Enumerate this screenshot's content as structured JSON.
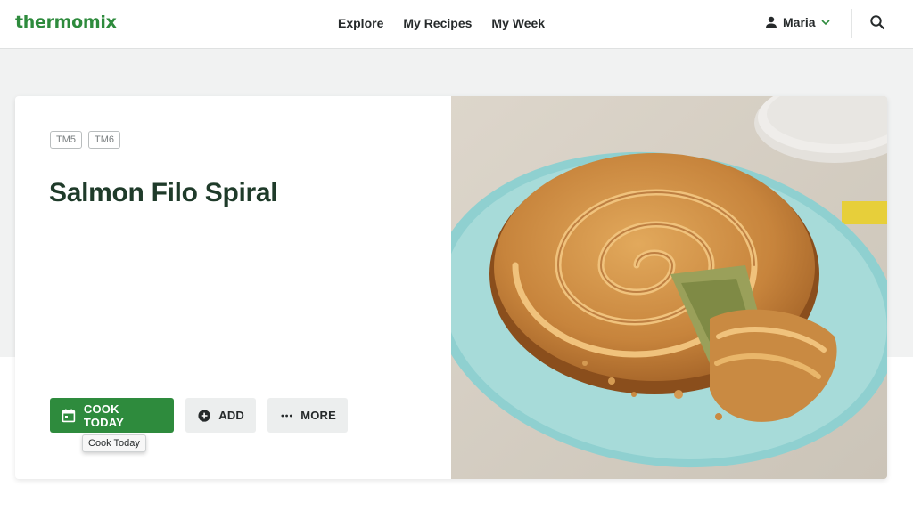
{
  "header": {
    "logo_text": "thermomix",
    "nav": [
      "Explore",
      "My Recipes",
      "My Week"
    ],
    "user_name": "Maria"
  },
  "recipe": {
    "tags": [
      "TM5",
      "TM6"
    ],
    "title": "Salmon Filo Spiral",
    "actions": {
      "cook_today": "COOK TODAY",
      "add": "ADD",
      "more": "MORE"
    },
    "tooltip": "Cook Today"
  },
  "colors": {
    "brand_green": "#2e8b3d",
    "title_green": "#1f3b2a",
    "secondary_button": "#eceeee"
  },
  "icons": {
    "user": "user-icon",
    "chevron": "chevron-down-icon",
    "search": "search-icon",
    "calendar": "calendar-icon",
    "add": "add-circle-icon",
    "more": "more-dots-icon"
  }
}
